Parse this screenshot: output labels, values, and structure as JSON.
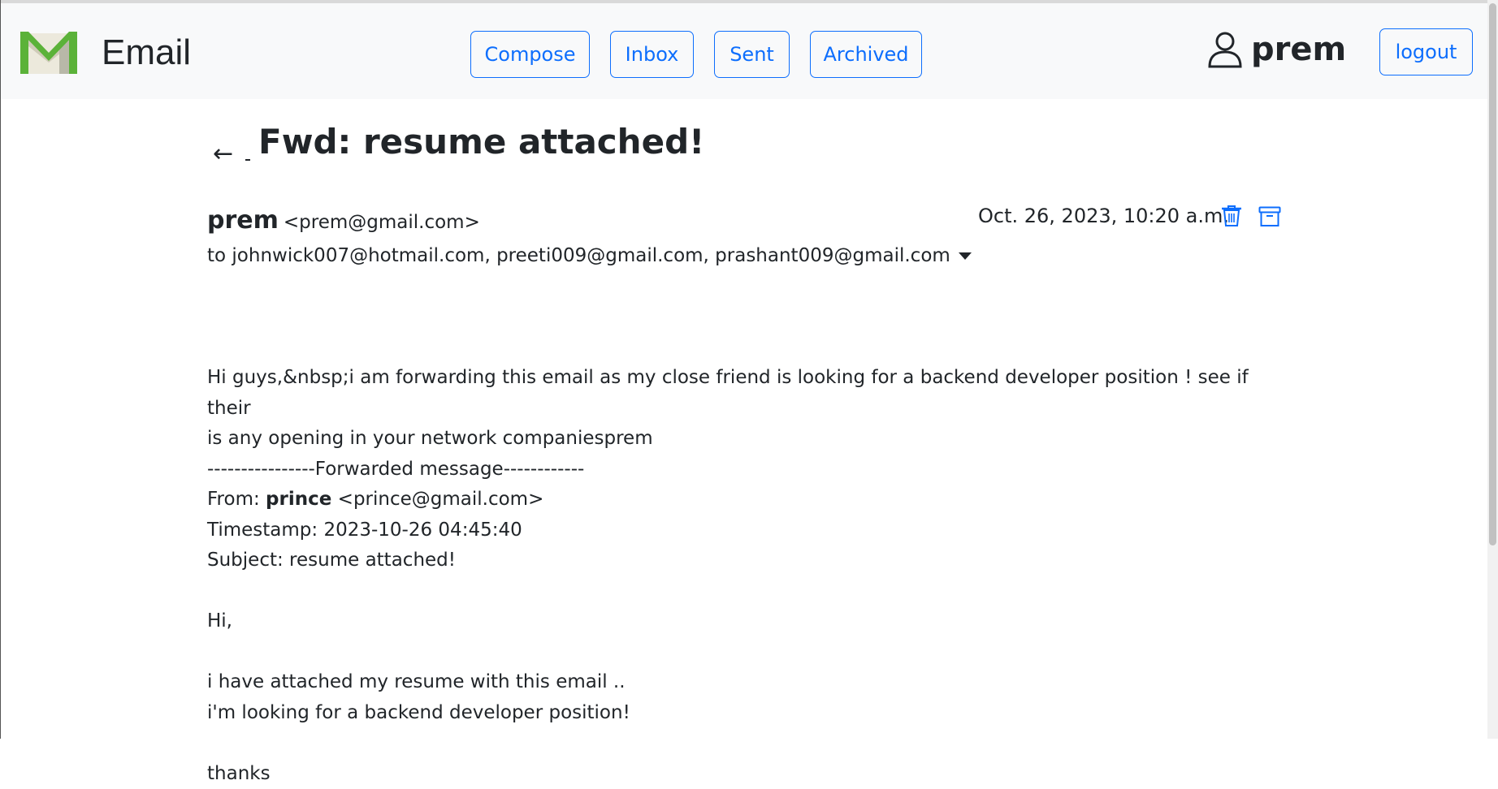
{
  "brand": {
    "name": "Email"
  },
  "nav": {
    "compose": "Compose",
    "inbox": "Inbox",
    "sent": "Sent",
    "archived": "Archived"
  },
  "user": {
    "name": "prem",
    "logout": "logout"
  },
  "email": {
    "subject": "Fwd: resume attached!",
    "from_name": "prem",
    "from_email": "<prem@gmail.com>",
    "to": "to johnwick007@hotmail.com, preeti009@gmail.com, prashant009@gmail.com",
    "timestamp": "Oct. 26, 2023, 10:20 a.m.",
    "body": {
      "line1": "Hi guys,&nbsp;i am forwarding this email as my close friend is looking for a backend developer position ! see if their",
      "line2": "is any opening in your network companiesprem",
      "line3": "----------------Forwarded message------------",
      "fwd_from_label": "From: ",
      "fwd_from_name": "prince",
      "fwd_from_email": " <prince@gmail.com>",
      "fwd_timestamp": "Timestamp: 2023-10-26 04:45:40",
      "fwd_subject": "Subject: resume attached!",
      "greeting": "Hi,",
      "line4": "i have attached my resume with this email ..",
      "line5": "i'm looking for a backend developer position!",
      "line6": "thanks"
    }
  },
  "colors": {
    "accent": "#0d6efd",
    "navbar_bg": "#f8f9fa",
    "logo_green": "#5bb239"
  }
}
